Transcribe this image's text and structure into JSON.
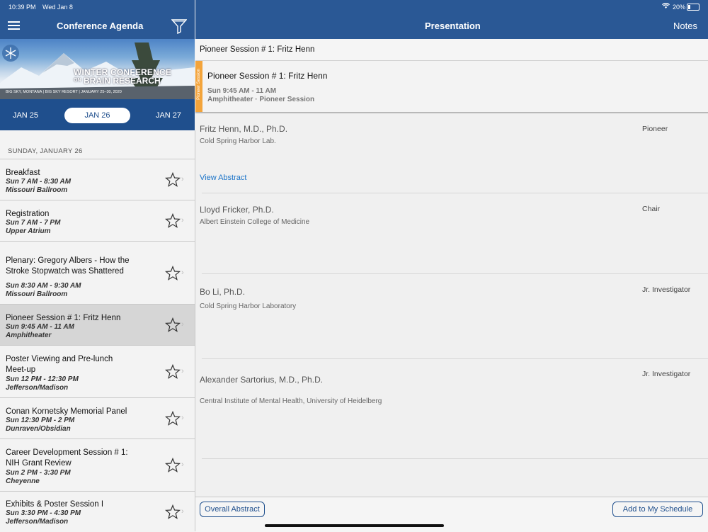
{
  "status_bar": {
    "time": "10:39 PM",
    "date": "Wed Jan 8",
    "battery": "20%"
  },
  "left_header": {
    "title": "Conference Agenda"
  },
  "banner": {
    "line1": "WINTER CONFERENCE",
    "line2_prefix": "ON",
    "line2": "BRAIN RESEARCH",
    "subline": "BIG SKY, MONTANA | BIG SKY RESORT | JANUARY 25–30, 2020"
  },
  "date_tabs": [
    {
      "label": "JAN 25",
      "selected": false
    },
    {
      "label": "JAN 26",
      "selected": true
    },
    {
      "label": "JAN 27",
      "selected": false
    }
  ],
  "day_header": "SUNDAY, JANUARY 26",
  "agenda": [
    {
      "title": "Breakfast",
      "time": "Sun 7 AM - 8:30 AM",
      "location": "Missouri Ballroom",
      "selected": false
    },
    {
      "title": "Registration",
      "time": "Sun 7 AM - 7 PM",
      "location": "Upper Atrium",
      "selected": false
    },
    {
      "title": "Plenary: Gregory Albers - How the Stroke Stopwatch was Shattered",
      "time": "Sun 8:30 AM - 9:30 AM",
      "location": "Missouri Ballroom",
      "selected": false
    },
    {
      "title": "Pioneer Session # 1: Fritz Henn",
      "time": "Sun 9:45 AM - 11 AM",
      "location": "Amphitheater",
      "selected": true
    },
    {
      "title": "Poster Viewing and Pre-lunch Meet-up",
      "time": "Sun 12 PM - 12:30 PM",
      "location": "Jefferson/Madison",
      "selected": false
    },
    {
      "title": "Conan Kornetsky Memorial Panel",
      "time": "Sun 12:30 PM - 2 PM",
      "location": "Dunraven/Obsidian",
      "selected": false
    },
    {
      "title": "Career Development Session # 1: NIH Grant Review",
      "time": "Sun 2 PM - 3:30 PM",
      "location": "Cheyenne",
      "selected": false
    },
    {
      "title": "Exhibits & Poster Session I",
      "time": "Sun 3:30 PM - 4:30 PM",
      "location": "Jefferson/Madison",
      "selected": false
    }
  ],
  "right_header": {
    "title": "Presentation",
    "notes_label": "Notes"
  },
  "detail": {
    "heading": "Pioneer Session # 1: Fritz Henn",
    "session_tag": "Pioneer Session",
    "session_title": "Pioneer Session # 1: Fritz Henn",
    "session_time": "Sun 9:45 AM - 11 AM",
    "session_location": "Amphitheater · Pioneer Session"
  },
  "speakers": [
    {
      "name": "Fritz Henn, M.D., Ph.D.",
      "affiliation": "Cold Spring Harbor Lab.",
      "role": "Pioneer",
      "link": "View Abstract"
    },
    {
      "name": "Lloyd Fricker, Ph.D.",
      "affiliation": "Albert Einstein College of Medicine",
      "role": "Chair"
    },
    {
      "name": "Bo Li, Ph.D.",
      "affiliation": "Cold Spring Harbor Laboratory",
      "role": "Jr. Investigator"
    },
    {
      "name": "Alexander Sartorius, M.D., Ph.D.",
      "affiliation": "Central Institute of Mental Health, University of Heidelberg",
      "role": "Jr. Investigator"
    }
  ],
  "bottom": {
    "overall_abstract": "Overall Abstract",
    "add_schedule": "Add to My Schedule"
  },
  "colors": {
    "nav_blue": "#2a5895",
    "accent_orange": "#f3a43b",
    "link_blue": "#1a73c8"
  }
}
